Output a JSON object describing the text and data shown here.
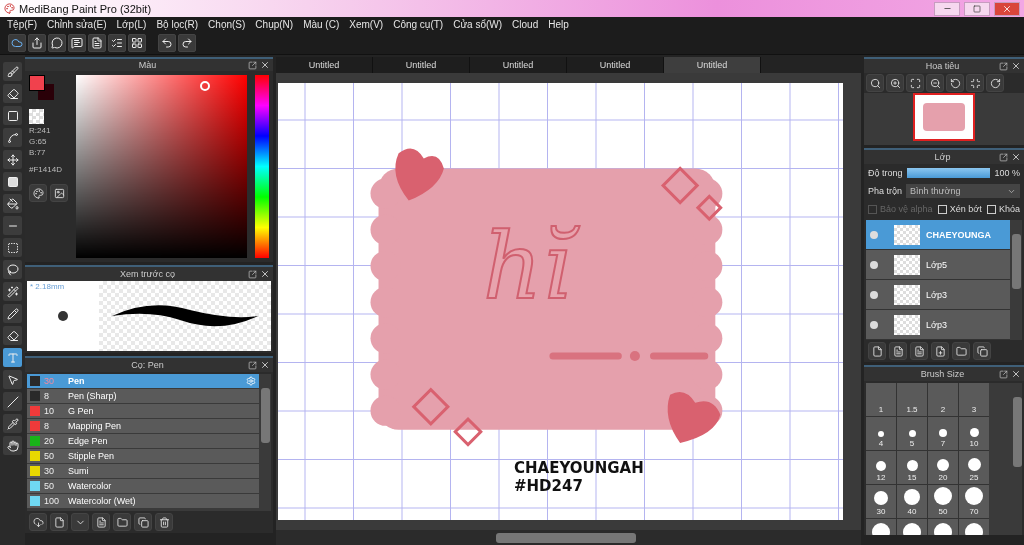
{
  "window": {
    "title": "MediBang Paint Pro (32bit)"
  },
  "menu": [
    "Tệp(F)",
    "Chỉnh sửa(E)",
    "Lớp(L)",
    "Bộ lọc(R)",
    "Chọn(S)",
    "Chụp(N)",
    "Màu (C)",
    "Xem(V)",
    "Công cụ(T)",
    "Cửa sổ(W)",
    "Cloud",
    "Help"
  ],
  "toolbar": [
    {
      "kind": "cloud"
    },
    {
      "kind": "share"
    },
    {
      "kind": "bubble"
    },
    {
      "kind": "comment"
    },
    {
      "kind": "page"
    },
    {
      "kind": "list"
    },
    {
      "kind": "grid"
    },
    {
      "kind": "undo"
    },
    {
      "kind": "redo"
    }
  ],
  "tools": [
    {
      "kind": "brush",
      "selected": false
    },
    {
      "kind": "eraser",
      "selected": false
    },
    {
      "kind": "shape",
      "selected": false
    },
    {
      "kind": "curve",
      "selected": false
    },
    {
      "kind": "move",
      "selected": false
    },
    {
      "kind": "fill",
      "selected": false
    },
    {
      "kind": "bucket",
      "selected": false
    },
    {
      "kind": "gradient",
      "selected": false
    },
    {
      "kind": "select",
      "selected": false
    },
    {
      "kind": "lasso",
      "selected": false
    },
    {
      "kind": "wand",
      "selected": false
    },
    {
      "kind": "selpen",
      "selected": false
    },
    {
      "kind": "selerase",
      "selected": false
    },
    {
      "kind": "text",
      "selected": true
    },
    {
      "kind": "operation",
      "selected": false
    },
    {
      "kind": "divide",
      "selected": false
    },
    {
      "kind": "dropper",
      "selected": false
    },
    {
      "kind": "hand",
      "selected": false
    }
  ],
  "color_panel": {
    "title": "Màu",
    "hex": "#F1414D",
    "rgb": [
      "R:241",
      "G:65",
      "B:77"
    ]
  },
  "brush_preview": {
    "title": "Xem trước cọ",
    "size": "* 2.18mm"
  },
  "brushes": {
    "title": "Cọ: Pen",
    "items": [
      {
        "size": "30",
        "name": "Pen",
        "color": "#2a2a2a",
        "selected": true
      },
      {
        "size": "8",
        "name": "Pen (Sharp)",
        "color": "#2a2a2a",
        "selected": false
      },
      {
        "size": "10",
        "name": "G Pen",
        "color": "#f03a3a",
        "selected": false
      },
      {
        "size": "8",
        "name": "Mapping Pen",
        "color": "#f03a3a",
        "selected": false
      },
      {
        "size": "20",
        "name": "Edge Pen",
        "color": "#18b418",
        "selected": false
      },
      {
        "size": "50",
        "name": "Stipple Pen",
        "color": "#e8d800",
        "selected": false
      },
      {
        "size": "30",
        "name": "Sumi",
        "color": "#e8d800",
        "selected": false
      },
      {
        "size": "50",
        "name": "Watercolor",
        "color": "#6fd8f2",
        "selected": false
      },
      {
        "size": "100",
        "name": "Watercolor (Wet)",
        "color": "#6fd8f2",
        "selected": false
      }
    ]
  },
  "tabs": [
    {
      "label": "Untitled",
      "selected": false
    },
    {
      "label": "Untitled",
      "selected": false
    },
    {
      "label": "Untitled",
      "selected": false
    },
    {
      "label": "Untitled",
      "selected": false
    },
    {
      "label": "Untitled",
      "selected": true
    }
  ],
  "canvas": {
    "lettering": "hĭ",
    "caption": [
      "CHAEYOUNGAH",
      "#HD247"
    ]
  },
  "navigator": {
    "title": "Hoa tiêu"
  },
  "layers": {
    "title": "Lớp",
    "opacity_label": "Độ trong",
    "opacity": {
      "level": 1,
      "reading": "100 %"
    },
    "blend_label": "Pha trộn",
    "blend": "Bình thường",
    "options": [
      {
        "label": "Bảo vệ alpha",
        "checked": false,
        "disabled": true
      },
      {
        "label": "Xén bớt",
        "checked": false,
        "disabled": false
      },
      {
        "label": "Khóa",
        "checked": false,
        "disabled": false
      }
    ],
    "items": [
      {
        "name": "CHAEYOUNGA",
        "selected": true
      },
      {
        "name": "Lớp5",
        "selected": false
      },
      {
        "name": "Lớp3",
        "selected": false
      },
      {
        "name": "Lớp3",
        "selected": false
      }
    ]
  },
  "brush_size": {
    "title": "Brush Size",
    "sizes": [
      "1",
      "1.5",
      "2",
      "3",
      "4",
      "5",
      "7",
      "10",
      "12",
      "15",
      "20",
      "25",
      "30",
      "40",
      "50",
      "70"
    ]
  }
}
